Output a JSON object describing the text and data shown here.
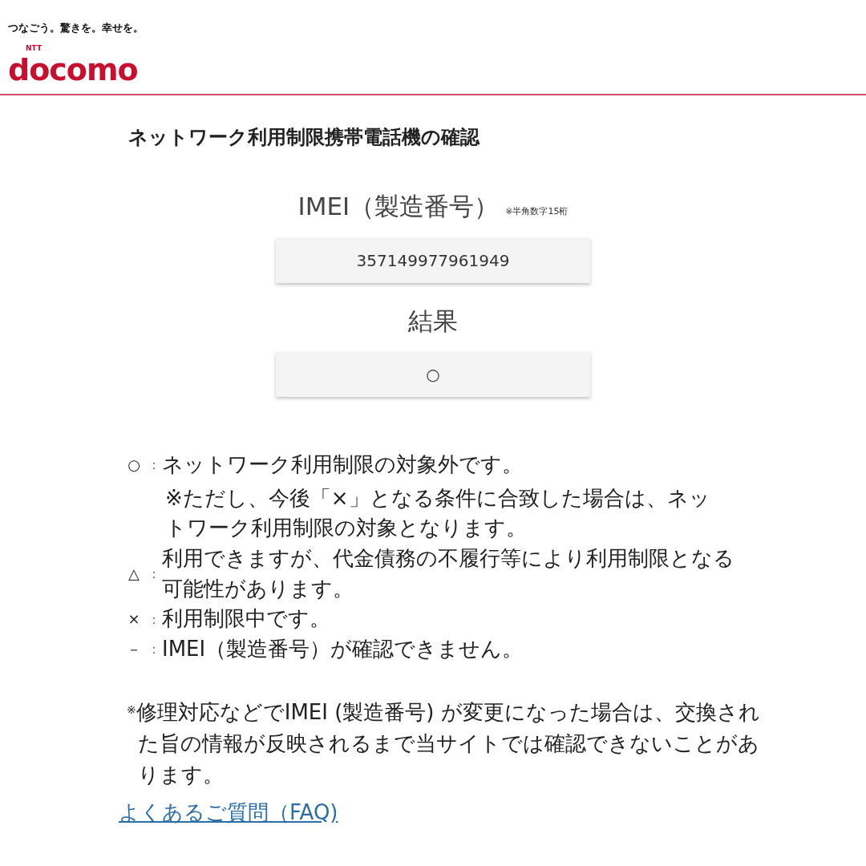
{
  "header": {
    "tagline": "つなごう。驚きを。幸せを。",
    "logo_small": "NTT",
    "logo": "docomo"
  },
  "title": "ネットワーク利用制限携帯電話機の確認",
  "imei": {
    "label": "IMEI（製造番号）",
    "hint": "※半角数字15桁",
    "value": "357149977961949"
  },
  "result": {
    "label": "結果",
    "value": "○"
  },
  "legend": [
    {
      "symbol": "○",
      "separator": "：",
      "text": "ネットワーク利用制限の対象外です。",
      "note": "※ただし、今後「×」となる条件に合致した場合は、ネットワーク利用制限の対象となります。"
    },
    {
      "symbol": "△",
      "separator": "：",
      "text": "利用できますが、代金債務の不履行等により利用制限となる可能性があります。"
    },
    {
      "symbol": "×",
      "separator": "：",
      "text": "利用制限中です。"
    },
    {
      "symbol": "－",
      "separator": "：",
      "text": "IMEI（製造番号）が確認できません。"
    }
  ],
  "footnote": "$^{※}$修理対応などでIMEI (製造番号) が変更になった場合は、交換された旨の情報が反映されるまで当サイトでは確認できないことがあります。",
  "faq_link": "よくあるご質問（FAQ)"
}
